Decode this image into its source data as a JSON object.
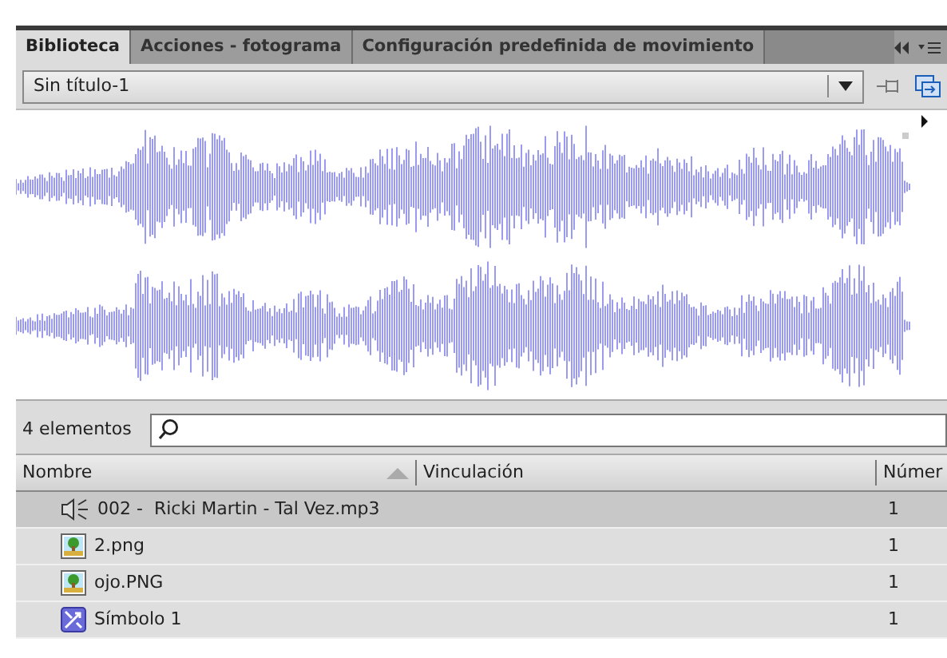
{
  "tabs": [
    {
      "label": "Biblioteca",
      "selected": true
    },
    {
      "label": "Acciones - fotograma",
      "selected": false
    },
    {
      "label": "Configuración predefinida de movimiento",
      "selected": false
    }
  ],
  "document_select": {
    "value": "Sin título-1"
  },
  "preview": {
    "kind": "waveform"
  },
  "item_count": "4 elementos",
  "columns": [
    "Nombre",
    "Vinculación",
    "Númer"
  ],
  "rows": [
    {
      "kind": "sound",
      "name": "002 -  Ricki Martin - Tal Vez.mp3",
      "uses": "1",
      "selected": true
    },
    {
      "kind": "bitmap",
      "name": "2.png",
      "uses": "1",
      "selected": false
    },
    {
      "kind": "bitmap",
      "name": "ojo.PNG",
      "uses": "1",
      "selected": false
    },
    {
      "kind": "symbol",
      "name": "Símbolo 1",
      "uses": "1",
      "selected": false
    }
  ]
}
